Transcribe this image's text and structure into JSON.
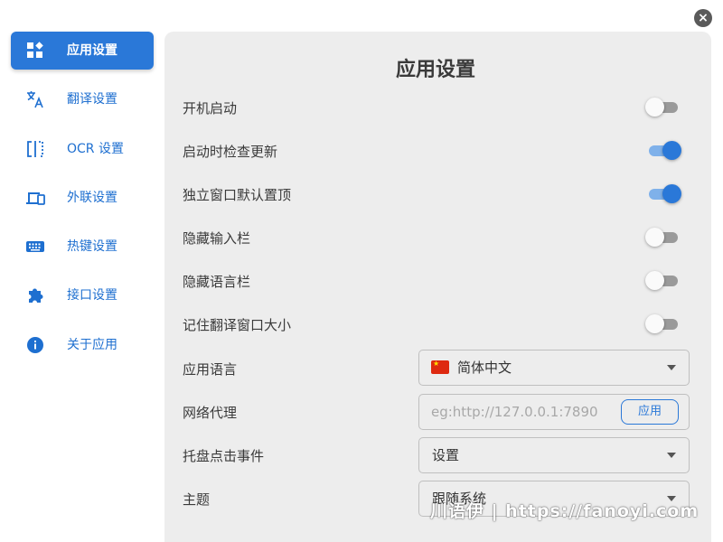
{
  "window": {
    "close_icon": "×"
  },
  "sidebar": {
    "items": [
      {
        "label": "应用设置",
        "icon": "widgets-icon",
        "active": true
      },
      {
        "label": "翻译设置",
        "icon": "translate-icon",
        "active": false
      },
      {
        "label": "OCR 设置",
        "icon": "ocr-icon",
        "active": false
      },
      {
        "label": "外联设置",
        "icon": "devices-icon",
        "active": false
      },
      {
        "label": "热键设置",
        "icon": "keyboard-icon",
        "active": false
      },
      {
        "label": "接口设置",
        "icon": "extension-icon",
        "active": false
      },
      {
        "label": "关于应用",
        "icon": "info-icon",
        "active": false
      }
    ]
  },
  "main": {
    "title": "应用设置",
    "toggles": [
      {
        "label": "开机启动",
        "on": false
      },
      {
        "label": "启动时检查更新",
        "on": true
      },
      {
        "label": "独立窗口默认置顶",
        "on": true
      },
      {
        "label": "隐藏输入栏",
        "on": false
      },
      {
        "label": "隐藏语言栏",
        "on": false
      },
      {
        "label": "记住翻译窗口大小",
        "on": false
      }
    ],
    "language": {
      "label": "应用语言",
      "value": "简体中文"
    },
    "proxy": {
      "label": "网络代理",
      "placeholder": "eg:http://127.0.0.1:7890",
      "button": "应用"
    },
    "tray": {
      "label": "托盘点击事件",
      "value": "设置"
    },
    "theme": {
      "label": "主题",
      "value": "跟随系统"
    }
  },
  "watermark": "川语伊 | https://fanoyi.com",
  "colors": {
    "accent": "#2a78d8",
    "panel": "#ededed",
    "toggle_on_track": "#7fb1ea"
  }
}
